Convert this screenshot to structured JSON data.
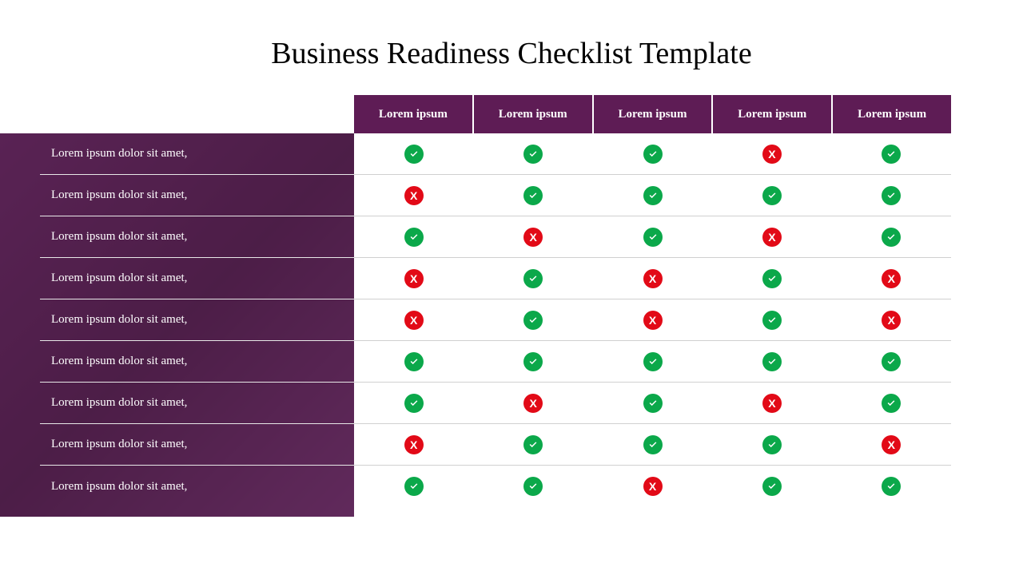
{
  "title": "Business Readiness Checklist Template",
  "columns": [
    "Lorem ipsum",
    "Lorem ipsum",
    "Lorem ipsum",
    "Lorem ipsum",
    "Lorem ipsum"
  ],
  "rows": [
    {
      "label": "Lorem ipsum dolor sit amet,",
      "cells": [
        "check",
        "check",
        "check",
        "cross",
        "check"
      ]
    },
    {
      "label": "Lorem ipsum dolor sit amet,",
      "cells": [
        "cross",
        "check",
        "check",
        "check",
        "check"
      ]
    },
    {
      "label": "Lorem ipsum dolor sit amet,",
      "cells": [
        "check",
        "cross",
        "check",
        "cross",
        "check"
      ]
    },
    {
      "label": "Lorem ipsum dolor sit amet,",
      "cells": [
        "cross",
        "check",
        "cross",
        "check",
        "cross"
      ]
    },
    {
      "label": "Lorem ipsum dolor sit amet,",
      "cells": [
        "cross",
        "check",
        "cross",
        "check",
        "cross"
      ]
    },
    {
      "label": "Lorem ipsum dolor sit amet,",
      "cells": [
        "check",
        "check",
        "check",
        "check",
        "check"
      ]
    },
    {
      "label": "Lorem ipsum dolor sit amet,",
      "cells": [
        "check",
        "cross",
        "check",
        "cross",
        "check"
      ]
    },
    {
      "label": "Lorem ipsum dolor sit amet,",
      "cells": [
        "cross",
        "check",
        "check",
        "check",
        "cross"
      ]
    },
    {
      "label": "Lorem ipsum dolor sit amet,",
      "cells": [
        "check",
        "check",
        "cross",
        "check",
        "check"
      ]
    }
  ],
  "colors": {
    "header_bg": "#5e1c55",
    "check_bg": "#0ba84a",
    "cross_bg": "#e20a17"
  }
}
